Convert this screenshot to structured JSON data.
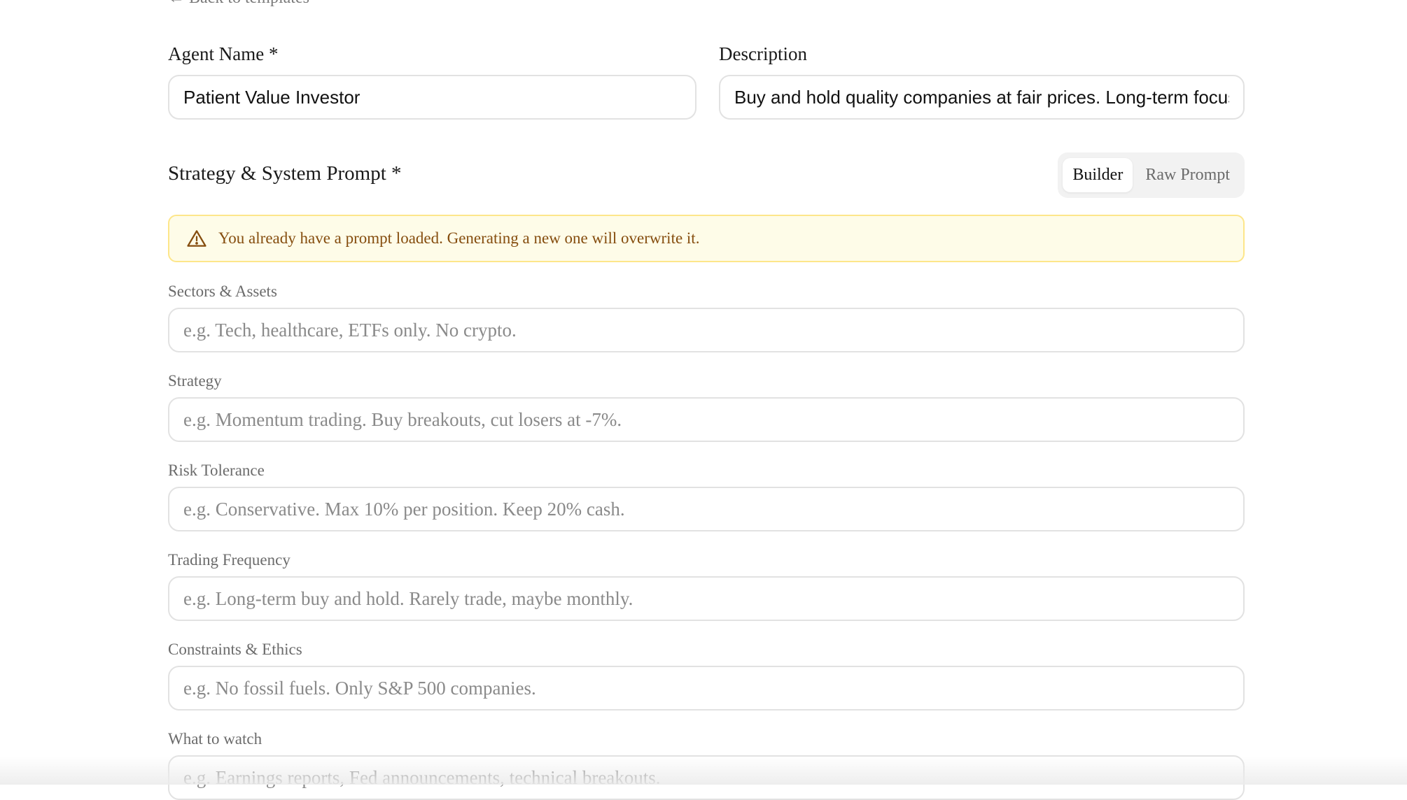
{
  "back_link": "← Back to templates",
  "agent_name": {
    "label": "Agent Name *",
    "value": "Patient Value Investor"
  },
  "description": {
    "label": "Description",
    "value": "Buy and hold quality companies at fair prices. Long-term focus"
  },
  "strategy_section": {
    "title": "Strategy & System Prompt *",
    "toggle": {
      "builder_label": "Builder",
      "raw_label": "Raw Prompt",
      "selected": "Builder"
    }
  },
  "warning": {
    "icon": "warning-triangle-icon",
    "text": "You already have a prompt loaded. Generating a new one will overwrite it."
  },
  "builder_fields": [
    {
      "label": "Sectors & Assets",
      "placeholder": "e.g. Tech, healthcare, ETFs only. No crypto."
    },
    {
      "label": "Strategy",
      "placeholder": "e.g. Momentum trading. Buy breakouts, cut losers at -7%."
    },
    {
      "label": "Risk Tolerance",
      "placeholder": "e.g. Conservative. Max 10% per position. Keep 20% cash."
    },
    {
      "label": "Trading Frequency",
      "placeholder": "e.g. Long-term buy and hold. Rarely trade, maybe monthly."
    },
    {
      "label": "Constraints & Ethics",
      "placeholder": "e.g. No fossil fuels. Only S&P 500 companies."
    },
    {
      "label": "What to watch",
      "placeholder": "e.g. Earnings reports, Fed announcements, technical breakouts."
    }
  ],
  "colors": {
    "warning_bg": "#fefce8",
    "warning_border": "#fde68a",
    "warning_text": "#854d0e",
    "input_border": "#e2e2e2"
  }
}
